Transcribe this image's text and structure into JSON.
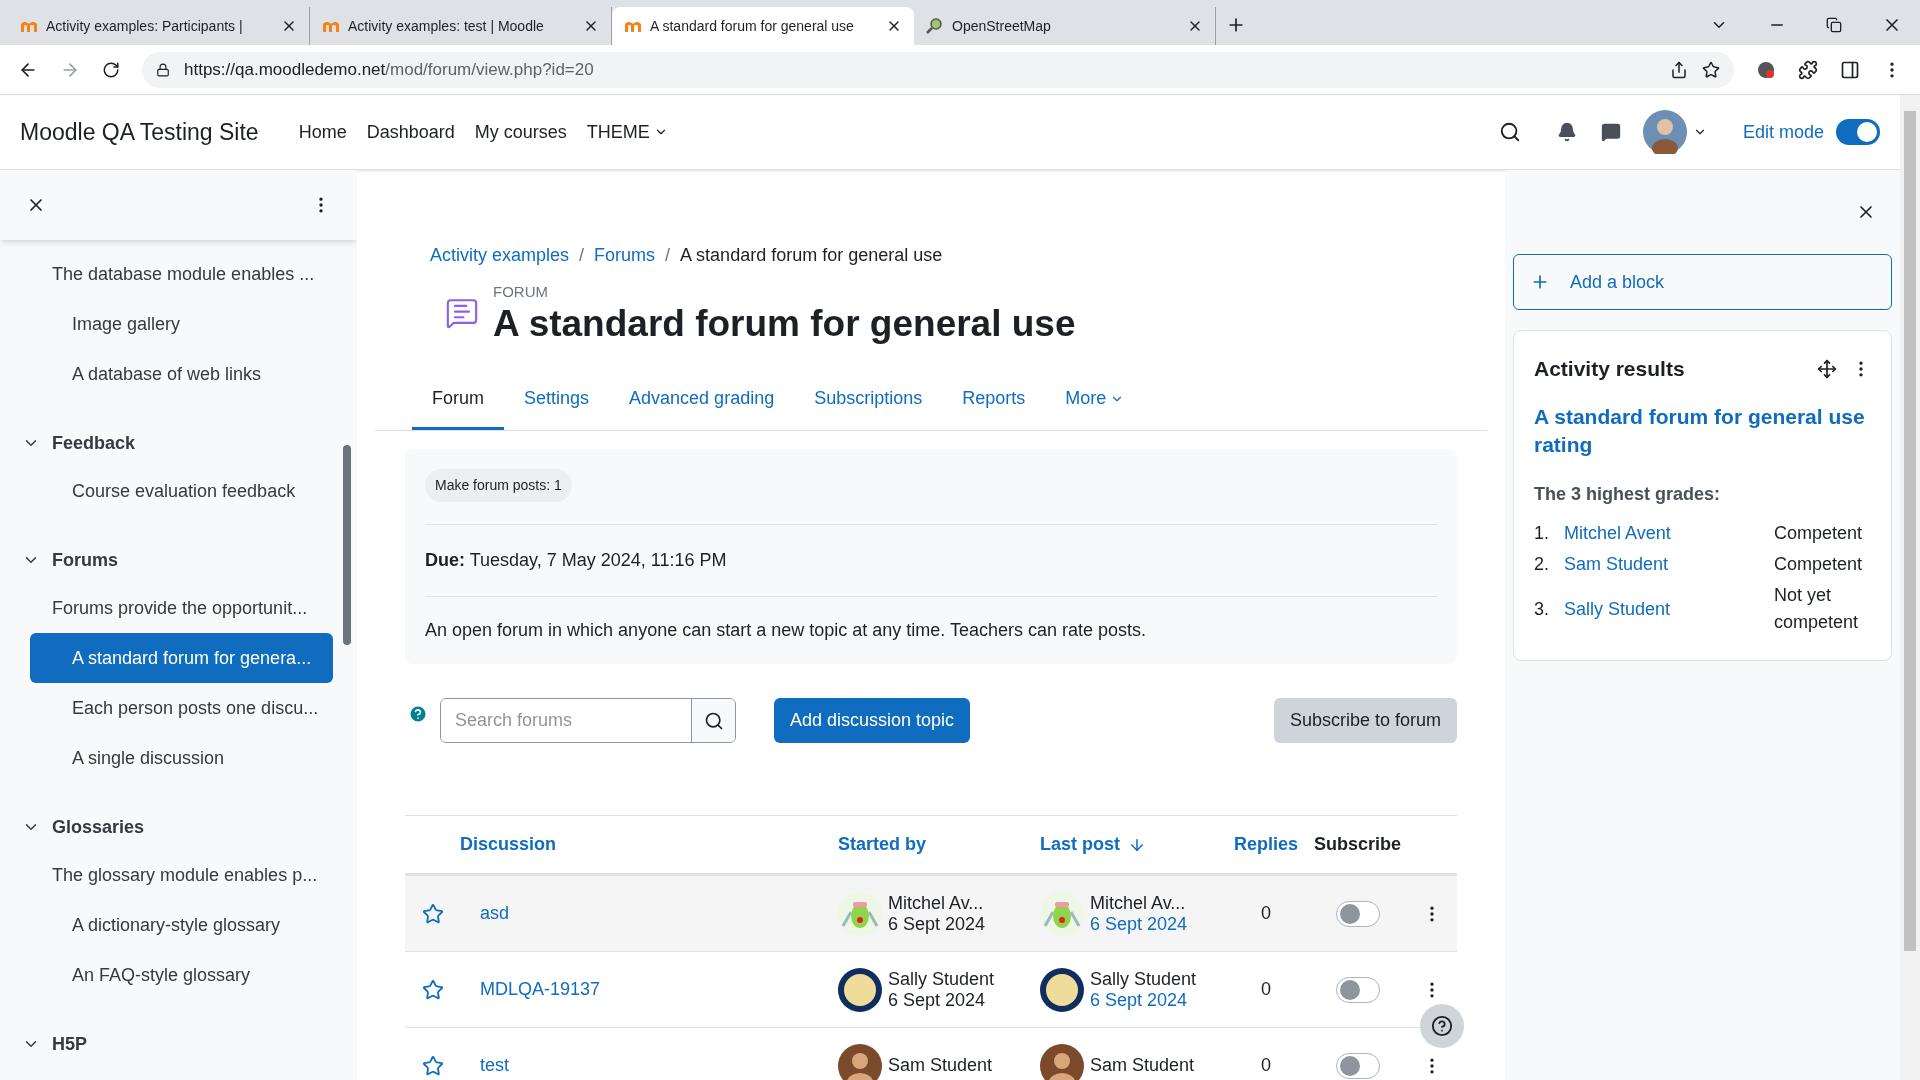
{
  "browser": {
    "tabs": [
      {
        "title": "Activity examples: Participants |",
        "selected": false
      },
      {
        "title": "Activity examples: test | Moodle",
        "selected": false
      },
      {
        "title": "A standard forum for general use",
        "selected": true
      },
      {
        "title": "OpenStreetMap",
        "selected": false
      }
    ],
    "url_host": "https://qa.moodledemo.net",
    "url_path": "/mod/forum/view.php?id=20"
  },
  "navbar": {
    "site_name": "Moodle QA Testing Site",
    "links": [
      {
        "label": "Home",
        "dropdown": false
      },
      {
        "label": "Dashboard",
        "dropdown": false
      },
      {
        "label": "My courses",
        "dropdown": false
      },
      {
        "label": "THEME",
        "dropdown": true
      }
    ],
    "edit_mode": {
      "label": "Edit mode",
      "on": true
    }
  },
  "sidebar": {
    "sections": [
      {
        "summary": "The database module enables ...",
        "items": [
          {
            "label": "Image gallery",
            "selected": false
          },
          {
            "label": "A database of web links",
            "selected": false
          }
        ]
      },
      {
        "title": "Feedback",
        "expanded": true,
        "items": [
          {
            "label": "Course evaluation feedback",
            "selected": false
          }
        ]
      },
      {
        "title": "Forums",
        "expanded": true,
        "summary": "Forums provide the opportunit...",
        "items": [
          {
            "label": "A standard forum for genera...",
            "selected": true
          },
          {
            "label": "Each person posts one discu...",
            "selected": false
          },
          {
            "label": "A single discussion",
            "selected": false
          }
        ]
      },
      {
        "title": "Glossaries",
        "expanded": true,
        "summary": "The glossary module enables p...",
        "items": [
          {
            "label": "A dictionary-style glossary",
            "selected": false
          },
          {
            "label": "An FAQ-style glossary",
            "selected": false
          }
        ]
      },
      {
        "title": "H5P",
        "expanded": true
      }
    ]
  },
  "main": {
    "breadcrumb": [
      "Activity examples",
      "Forums",
      "A standard forum for general use"
    ],
    "breadcrumb_separator": "/",
    "module_label": "FORUM",
    "title": "A standard forum for general use",
    "tabs": [
      {
        "label": "Forum",
        "selected": true,
        "dropdown": false
      },
      {
        "label": "Settings",
        "selected": false,
        "dropdown": false
      },
      {
        "label": "Advanced grading",
        "selected": false,
        "dropdown": false
      },
      {
        "label": "Subscriptions",
        "selected": false,
        "dropdown": false
      },
      {
        "label": "Reports",
        "selected": false,
        "dropdown": false
      },
      {
        "label": "More",
        "selected": false,
        "dropdown": true
      }
    ],
    "completion": "Make forum posts: 1",
    "due": "**Due:** Tuesday, 7 May 2024, 11:16 PM",
    "description": "An open forum in which anyone can start a new topic at any time. Teachers can rate posts.",
    "search_placeholder": "Search forums",
    "add_button": "Add discussion topic",
    "subscribe_button": "Subscribe to forum",
    "table": {
      "columns": [
        {
          "label": "Discussion",
          "sortable": true,
          "sorted": false
        },
        {
          "label": "Started by",
          "sortable": true,
          "sorted": false
        },
        {
          "label": "Last post",
          "sortable": true,
          "sorted": true
        },
        {
          "label": "Replies",
          "sortable": true,
          "sorted": false
        },
        {
          "label": "Subscribe",
          "sortable": false,
          "sorted": false
        }
      ],
      "rows": [
        {
          "starred": false,
          "discussion": "asd",
          "started_by": {
            "name": "Mitchel Av...",
            "date": "6 Sept 2024"
          },
          "last_post": {
            "name": "Mitchel Av...",
            "date": "6 Sept 2024"
          },
          "replies": "0",
          "subscribed": false
        },
        {
          "starred": false,
          "discussion": "MDLQA-19137",
          "started_by": {
            "name": "Sally Student",
            "date": "6 Sept 2024"
          },
          "last_post": {
            "name": "Sally Student",
            "date": "6 Sept 2024"
          },
          "replies": "0",
          "subscribed": false
        },
        {
          "starred": false,
          "discussion": "test",
          "started_by": {
            "name": "Sam Student"
          },
          "last_post": {
            "name": "Sam Student"
          },
          "replies": "0",
          "subscribed": false
        }
      ]
    }
  },
  "blocks": {
    "add_block": "Add a block",
    "card": {
      "title": "Activity results",
      "link": "A standard forum for general use rating",
      "subtitle": "The 3 highest grades:",
      "grades": [
        {
          "rank": "1.",
          "name": "Mitchel Avent",
          "grade": "Competent"
        },
        {
          "rank": "2.",
          "name": "Sam Student",
          "grade": "Competent"
        },
        {
          "rank": "3.",
          "name": "Sally Student",
          "grade": "Not yet competent"
        }
      ]
    }
  }
}
